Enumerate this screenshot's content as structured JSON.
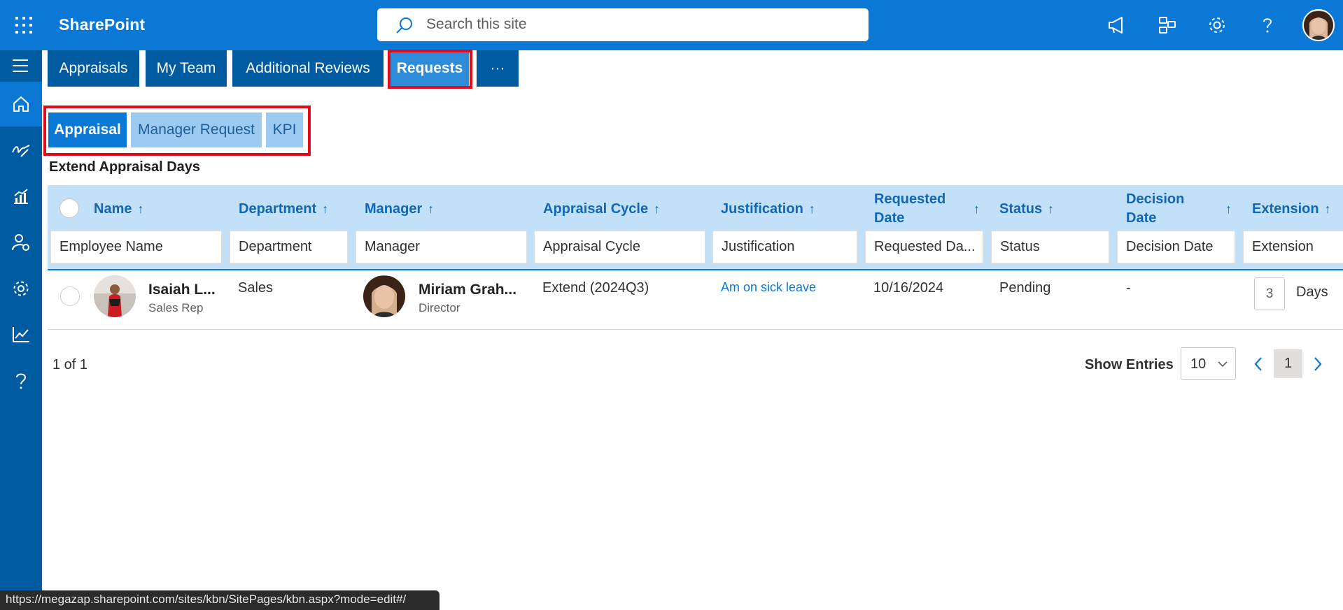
{
  "app": {
    "brand": "SharePoint"
  },
  "search": {
    "placeholder": "Search this site"
  },
  "nav_tabs": [
    {
      "label": "Appraisals"
    },
    {
      "label": "My Team"
    },
    {
      "label": "Additional Reviews"
    },
    {
      "label": "Requests"
    },
    {
      "label": "···"
    }
  ],
  "sub_tabs": [
    {
      "label": "Appraisal"
    },
    {
      "label": "Manager Request"
    },
    {
      "label": "KPI"
    }
  ],
  "section_title": "Extend Appraisal Days",
  "table": {
    "headers": {
      "name": "Name",
      "department": "Department",
      "manager": "Manager",
      "cycle": "Appraisal Cycle",
      "justification": "Justification",
      "requested_1": "Requested",
      "requested_2": "Date",
      "status": "Status",
      "decision_1": "Decision",
      "decision_2": "Date",
      "extension": "Extension",
      "sort_arrow": "↑"
    },
    "filters": {
      "name": "Employee Name",
      "department": "Department",
      "manager": "Manager",
      "cycle": "Appraisal Cycle",
      "justification": "Justification",
      "requested": "Requested Da...",
      "status": "Status",
      "decision": "Decision Date",
      "extension": "Extension"
    },
    "rows": [
      {
        "name": "Isaiah L...",
        "role": "Sales Rep",
        "department": "Sales",
        "manager_name": "Miriam Grah...",
        "manager_role": "Director",
        "cycle": "Extend (2024Q3)",
        "justification": "Am on sick leave",
        "requested": "10/16/2024",
        "status": "Pending",
        "decision": "-",
        "extension_value": "3",
        "extension_unit": "Days"
      }
    ]
  },
  "pager": {
    "summary": "1 of 1",
    "show_entries_label": "Show Entries",
    "entries_value": "10",
    "current_page": "1"
  },
  "status_url": "https://megazap.sharepoint.com/sites/kbn/SitePages/kbn.aspx?mode=edit#/",
  "colors": {
    "suite": "#0a78d4",
    "rail": "#005ba1",
    "highlight": "#e00b1c",
    "header_row": "#c2e0f8"
  },
  "icons": [
    "app-launcher-icon",
    "search-icon",
    "megaphone-icon",
    "share-network-icon",
    "settings-icon",
    "help-icon",
    "hamburger-icon",
    "home-icon",
    "pen-icon",
    "chart-icon",
    "person-gear-icon",
    "gear-icon",
    "trend-icon",
    "question-icon"
  ]
}
